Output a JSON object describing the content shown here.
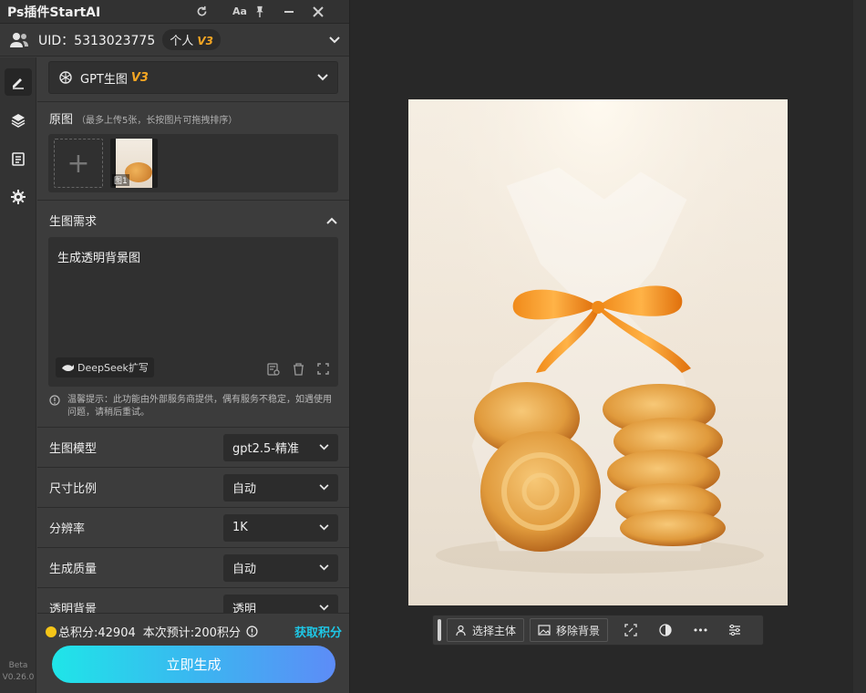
{
  "app": {
    "title": "Ps插件StartAI"
  },
  "titlebar": {
    "icons": [
      "refresh-icon",
      "font-size-icon",
      "pin-icon",
      "minimize-icon",
      "close-icon"
    ],
    "font_size_glyph": "Aa"
  },
  "user": {
    "uid_text": "UID：5313023775",
    "plan_label": "个人",
    "plan_version": "V3"
  },
  "model_selector": {
    "label": "GPT生图",
    "version": "V3"
  },
  "source_images": {
    "title": "原图",
    "hint": "（最多上传5张，长按图片可拖拽排序）",
    "add_symbol": "+",
    "thumbnails": [
      {
        "label": "图1"
      }
    ]
  },
  "requirement": {
    "title": "生图需求",
    "prompt_text": "生成透明背景图",
    "deepseek_label": "DeepSeek扩写",
    "tip": "温馨提示：此功能由外部服务商提供，偶有服务不稳定，如遇使用问题，请稍后重试。"
  },
  "settings": [
    {
      "label": "生图模型",
      "value": "gpt2.5-精准"
    },
    {
      "label": "尺寸比例",
      "value": "自动"
    },
    {
      "label": "分辨率",
      "value": "1K"
    },
    {
      "label": "生成质量",
      "value": "自动"
    },
    {
      "label": "透明背景",
      "value": "透明"
    }
  ],
  "footer": {
    "total_points": "总积分:42904",
    "estimate": "本次预计:200积分",
    "get_points": "获取积分",
    "generate_button": "立即生成"
  },
  "sidebar": {
    "beta_label": "Beta",
    "version": "V0.26.0",
    "icons": [
      "edit-icon",
      "layers-icon",
      "clipboard-icon",
      "settings-icon"
    ]
  },
  "image_toolbar": {
    "select_subject": "选择主体",
    "remove_background": "移除背景",
    "more_glyph": "•••"
  },
  "colors": {
    "accent_cyan": "#1ec7e6",
    "version_orange": "#f5a623",
    "generate_gradient_start": "#1fe5e8",
    "generate_gradient_end": "#5d8cf7"
  }
}
